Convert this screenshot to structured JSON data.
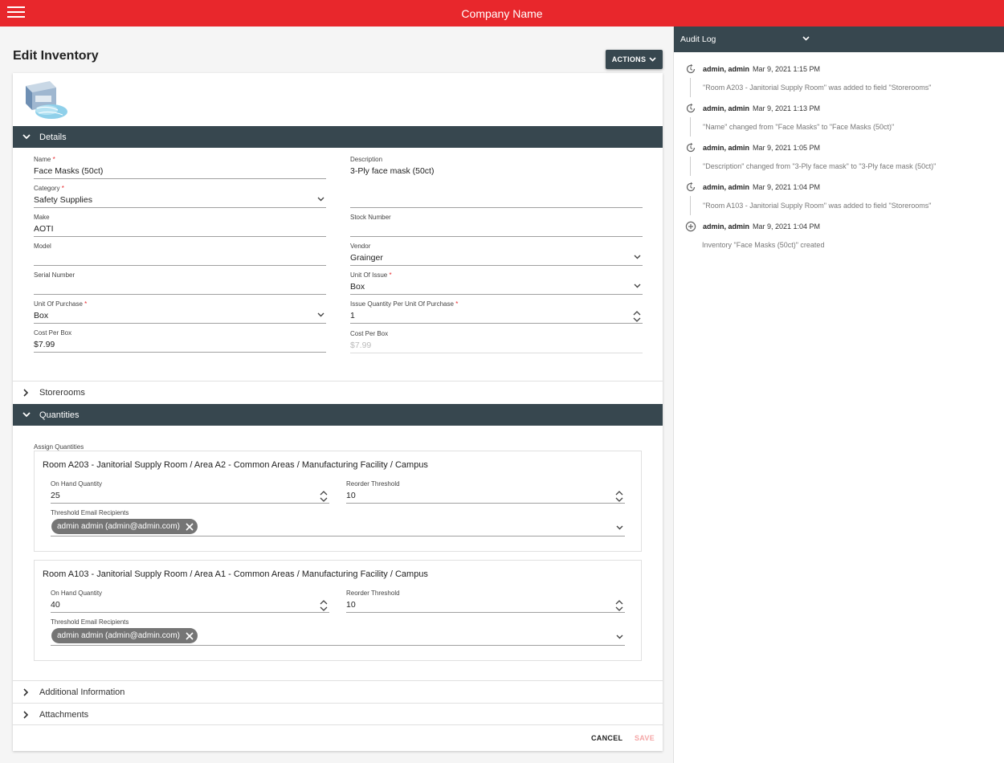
{
  "header": {
    "title": "Company Name"
  },
  "page": {
    "title": "Edit Inventory",
    "actions_label": "ACTIONS"
  },
  "sections": {
    "details": "Details",
    "storerooms": "Storerooms",
    "quantities": "Quantities",
    "additional": "Additional Information",
    "attachments": "Attachments"
  },
  "details": {
    "name_label": "Name",
    "name_value": "Face Masks (50ct)",
    "description_label": "Description",
    "description_value": "3-Ply face mask (50ct)",
    "category_label": "Category",
    "category_value": "Safety Supplies",
    "make_label": "Make",
    "make_value": "AOTI",
    "stock_label": "Stock Number",
    "stock_value": "",
    "model_label": "Model",
    "model_value": "",
    "vendor_label": "Vendor",
    "vendor_value": "Grainger",
    "serial_label": "Serial Number",
    "serial_value": "",
    "unit_issue_label": "Unit Of Issue",
    "unit_issue_value": "Box",
    "unit_purchase_label": "Unit Of Purchase",
    "unit_purchase_value": "Box",
    "issue_qty_label": "Issue Quantity Per Unit Of Purchase",
    "issue_qty_value": "1",
    "cost_label": "Cost Per Box",
    "cost_value": "$7.99",
    "cost2_label": "Cost Per Box",
    "cost2_value": "$7.99",
    "required_mark": "*"
  },
  "quantities": {
    "assign_label": "Assign Quantities",
    "on_hand_label": "On Hand Quantity",
    "reorder_label": "Reorder Threshold",
    "email_label": "Threshold Email Recipients",
    "rooms": [
      {
        "title": "Room A203 - Janitorial Supply Room / Area A2 - Common Areas / Manufacturing Facility / Campus",
        "on_hand": "25",
        "reorder": "10",
        "recipient": "admin admin (admin@admin.com)"
      },
      {
        "title": "Room A103 - Janitorial Supply Room / Area A1 - Common Areas / Manufacturing Facility / Campus",
        "on_hand": "40",
        "reorder": "10",
        "recipient": "admin admin (admin@admin.com)"
      }
    ]
  },
  "footer": {
    "cancel": "CANCEL",
    "save": "SAVE"
  },
  "audit": {
    "title": "Audit Log",
    "entries": [
      {
        "who": "admin, admin",
        "when": "Mar 9, 2021 1:15 PM",
        "msg": "\"Room A203 - Janitorial Supply Room\" was added to field \"Storerooms\"",
        "icon": "history-icon"
      },
      {
        "who": "admin, admin",
        "when": "Mar 9, 2021 1:13 PM",
        "msg": "\"Name\" changed from \"Face Masks\" to \"Face Masks (50ct)\"",
        "icon": "history-icon"
      },
      {
        "who": "admin, admin",
        "when": "Mar 9, 2021 1:05 PM",
        "msg": "\"Description\" changed from \"3-Ply face mask\" to \"3-Ply face mask (50ct)\"",
        "icon": "history-icon"
      },
      {
        "who": "admin, admin",
        "when": "Mar 9, 2021 1:04 PM",
        "msg": "\"Room A103 - Janitorial Supply Room\" was added to field \"Storerooms\"",
        "icon": "history-icon"
      },
      {
        "who": "admin, admin",
        "when": "Mar 9, 2021 1:04 PM",
        "msg": "Inventory \"Face Masks (50ct)\" created",
        "icon": "add-circle-icon"
      }
    ]
  },
  "colors": {
    "brand": "#e8272c",
    "header_dark": "#37474f"
  }
}
